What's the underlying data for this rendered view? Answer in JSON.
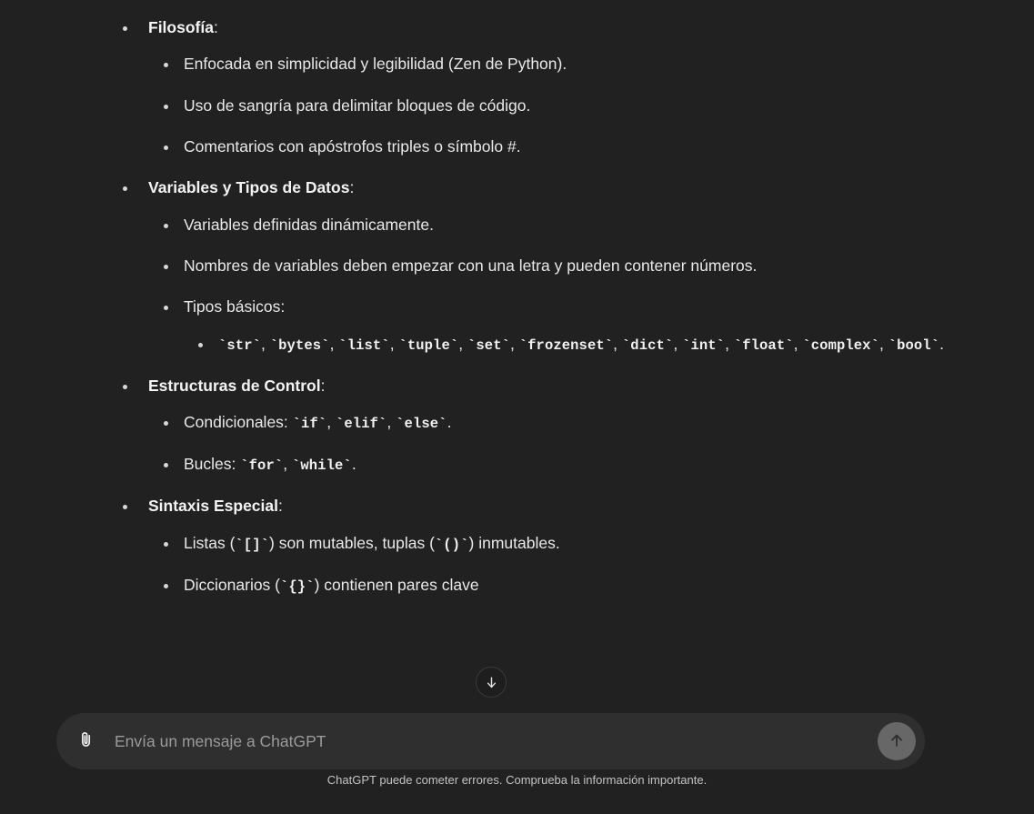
{
  "app": {
    "name": "ChatGPT",
    "background_color": "#212121",
    "composer_color": "#2f2f2f",
    "text_color": "#ececec"
  },
  "message": {
    "sections": [
      {
        "heading": "Filosofía",
        "heading_suffix": ":",
        "items": [
          {
            "text": "Enfocada en simplicidad y legibilidad (Zen de Python)."
          },
          {
            "text": "Uso de sangría para delimitar bloques de código."
          },
          {
            "text": "Comentarios con apóstrofos triples o símbolo #."
          }
        ]
      },
      {
        "heading": "Variables y Tipos de Datos",
        "heading_suffix": ":",
        "items": [
          {
            "text": "Variables definidas dinámicamente."
          },
          {
            "text": "Nombres de variables deben empezar con una letra y pueden contener números."
          },
          {
            "text": "Tipos básicos:",
            "subitems": [
              {
                "parts": [
                  {
                    "type": "code",
                    "text": "`str`"
                  },
                  {
                    "type": "text",
                    "text": ", "
                  },
                  {
                    "type": "code",
                    "text": "`bytes`"
                  },
                  {
                    "type": "text",
                    "text": ", "
                  },
                  {
                    "type": "code",
                    "text": "`list`"
                  },
                  {
                    "type": "text",
                    "text": ", "
                  },
                  {
                    "type": "code",
                    "text": "`tuple`"
                  },
                  {
                    "type": "text",
                    "text": ", "
                  },
                  {
                    "type": "code",
                    "text": "`set`"
                  },
                  {
                    "type": "text",
                    "text": ", "
                  },
                  {
                    "type": "code",
                    "text": "`frozenset`"
                  },
                  {
                    "type": "text",
                    "text": ", "
                  },
                  {
                    "type": "code",
                    "text": "`dict`"
                  },
                  {
                    "type": "text",
                    "text": ", "
                  },
                  {
                    "type": "code",
                    "text": "`int`"
                  },
                  {
                    "type": "text",
                    "text": ", "
                  },
                  {
                    "type": "code",
                    "text": "`float`"
                  },
                  {
                    "type": "text",
                    "text": ", "
                  },
                  {
                    "type": "code",
                    "text": "`complex`"
                  },
                  {
                    "type": "text",
                    "text": ", "
                  },
                  {
                    "type": "code",
                    "text": "`bool`"
                  },
                  {
                    "type": "text",
                    "text": "."
                  }
                ]
              }
            ]
          }
        ]
      },
      {
        "heading": "Estructuras de Control",
        "heading_suffix": ":",
        "items": [
          {
            "parts": [
              {
                "type": "text",
                "text": "Condicionales: "
              },
              {
                "type": "code",
                "text": "`if`"
              },
              {
                "type": "text",
                "text": ", "
              },
              {
                "type": "code",
                "text": "`elif`"
              },
              {
                "type": "text",
                "text": ", "
              },
              {
                "type": "code",
                "text": "`else`"
              },
              {
                "type": "text",
                "text": "."
              }
            ]
          },
          {
            "parts": [
              {
                "type": "text",
                "text": "Bucles: "
              },
              {
                "type": "code",
                "text": "`for`"
              },
              {
                "type": "text",
                "text": ", "
              },
              {
                "type": "code",
                "text": "`while`"
              },
              {
                "type": "text",
                "text": "."
              }
            ]
          }
        ]
      },
      {
        "heading": "Sintaxis Especial",
        "heading_suffix": ":",
        "items": [
          {
            "parts": [
              {
                "type": "text",
                "text": "Listas ("
              },
              {
                "type": "code",
                "text": "`[]`"
              },
              {
                "type": "text",
                "text": ") son mutables, tuplas ("
              },
              {
                "type": "code",
                "text": "`()`"
              },
              {
                "type": "text",
                "text": ") inmutables."
              }
            ]
          },
          {
            "parts": [
              {
                "type": "text",
                "text": "Diccionarios ("
              },
              {
                "type": "code",
                "text": "`{}`"
              },
              {
                "type": "text",
                "text": ") contienen pares clave"
              }
            ]
          }
        ]
      }
    ]
  },
  "scroll_button": {
    "icon": "arrow-down-icon",
    "title": "Desplazarse hacia abajo"
  },
  "composer": {
    "attach_icon": "paperclip-icon",
    "placeholder": "Envía un mensaje a ChatGPT",
    "value": "",
    "send_icon": "arrow-up-icon",
    "send_button_color": "#676767"
  },
  "footer": {
    "note": "ChatGPT puede cometer errores. Comprueba la información importante."
  }
}
